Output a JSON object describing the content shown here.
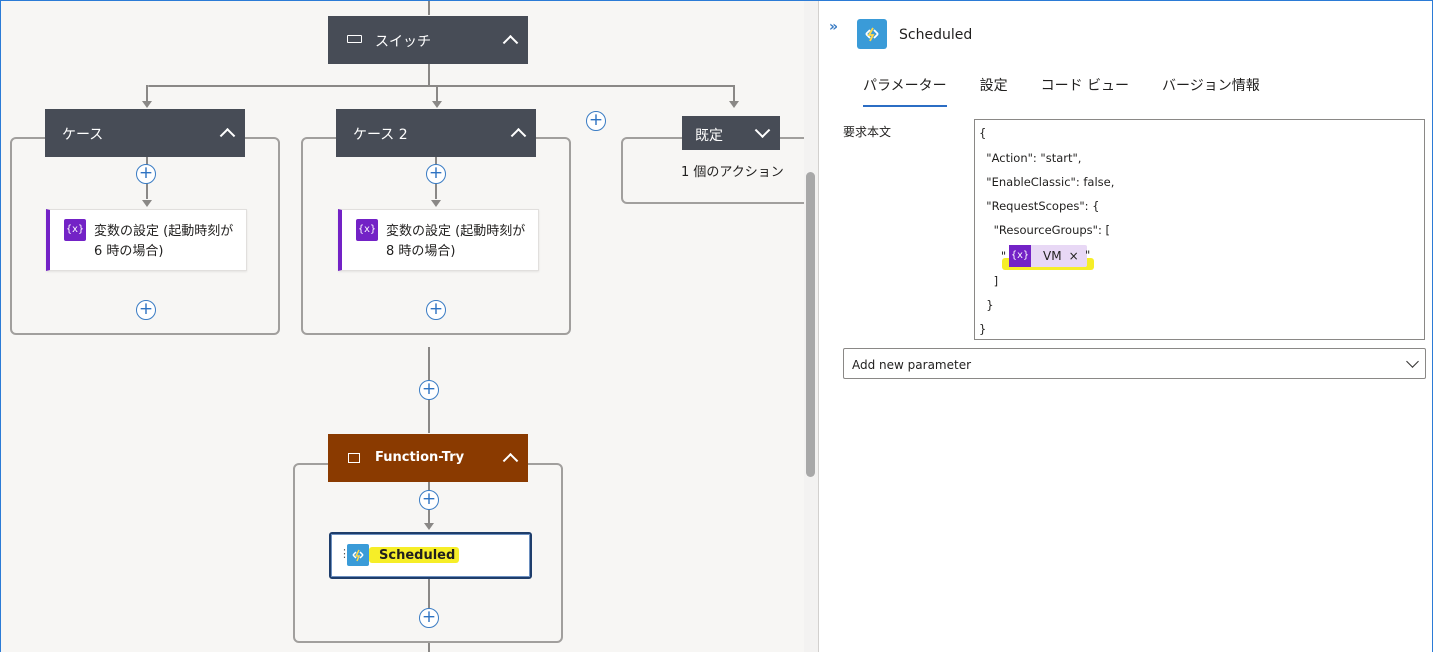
{
  "flow": {
    "switch": {
      "title": "スイッチ"
    },
    "cases": [
      {
        "title": "ケース",
        "action_label": "変数の設定 (起動時刻が 6 時の場合)"
      },
      {
        "title": "ケース 2",
        "action_label": "変数の設定 (起動時刻が 8 時の場合)"
      }
    ],
    "default_case": {
      "title": "既定",
      "summary": "1 個のアクション"
    },
    "scope": {
      "title": "Function-Try"
    },
    "function_action": {
      "label": "Scheduled"
    },
    "icons": {
      "variable": "{x}",
      "add": "+",
      "switch": "switch-icon",
      "scope": "scope-icon",
      "function": "azure-function-icon"
    }
  },
  "panel": {
    "collapse": "»",
    "title": "Scheduled",
    "tabs": [
      "パラメーター",
      "設定",
      "コード ビュー",
      "バージョン情報"
    ],
    "active_tab": "パラメーター",
    "field_label": "要求本文",
    "body_lines": [
      "{",
      "  \"Action\": \"start\",",
      "  \"EnableClassic\": false,",
      "  \"RequestScopes\": {",
      "    \"ResourceGroups\": [",
      "      \"",
      "    ]",
      "  }",
      "}"
    ],
    "token": {
      "icon": "{x}",
      "label": "VM",
      "remove": "×",
      "close_quote": "\""
    },
    "add_param": {
      "placeholder": "Add new parameter"
    }
  },
  "colors": {
    "header_dark": "#474c56",
    "scope_header": "#8a3a00",
    "variable_purple": "#7322c6",
    "function_blue": "#3a9bd8",
    "highlight": "#f6ee28",
    "accent": "#2b6dc4"
  }
}
